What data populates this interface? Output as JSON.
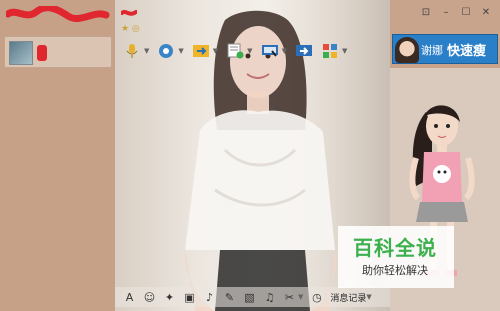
{
  "contacts": {
    "items": [
      {
        "name_redacted": true
      }
    ]
  },
  "chat": {
    "toolbar": {
      "items": [
        "microphone-icon",
        "camera-icon",
        "file-transfer-icon",
        "screenshot-doc-icon",
        "remote-desktop-icon",
        "share-screen-icon",
        "apps-grid-icon"
      ]
    },
    "bottom_toolbar": {
      "font_label": "A",
      "message_record_label": "消息记录"
    }
  },
  "ad": {
    "name": "谢娜",
    "slogan": "快速瘦",
    "colors": {
      "background": "#2a7fc9"
    }
  },
  "watermark": {
    "title": "百科全说",
    "subtitle": "助你轻松解决",
    "color": "#3db04e"
  },
  "window_controls": {
    "icons": [
      "pin-icon",
      "minimize-icon",
      "maximize-icon",
      "close-icon"
    ],
    "labels": [
      "⊡",
      "–",
      "☐",
      "✕"
    ]
  }
}
